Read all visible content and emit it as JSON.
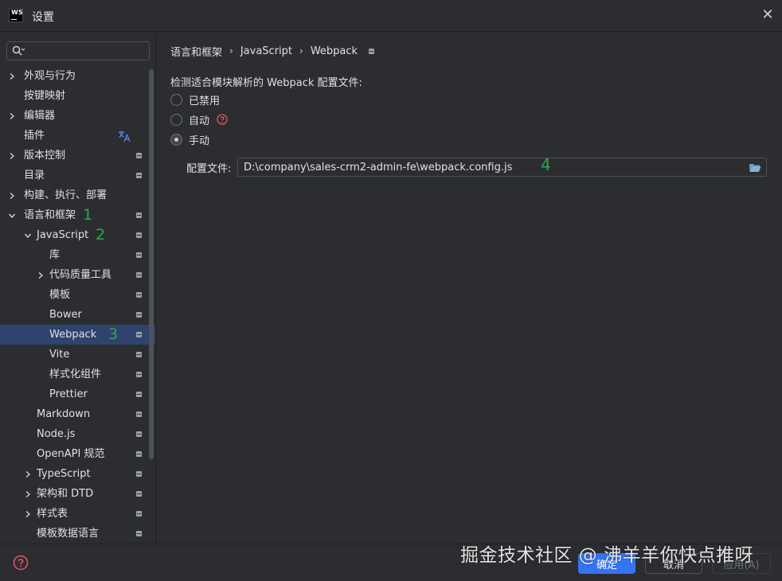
{
  "window": {
    "title": "设置",
    "logo_text": "WS"
  },
  "sidebar": {
    "search_placeholder": "",
    "items": [
      {
        "label": "外观与行为",
        "chevron": "right",
        "indent": 0,
        "badge": false
      },
      {
        "label": "按键映射",
        "chevron": null,
        "indent": 0,
        "badge": false
      },
      {
        "label": "编辑器",
        "chevron": "right",
        "indent": 0,
        "badge": false
      },
      {
        "label": "插件",
        "chevron": null,
        "indent": 0,
        "badge": false,
        "icon": "translate-icon"
      },
      {
        "label": "版本控制",
        "chevron": "right",
        "indent": 0,
        "badge": true
      },
      {
        "label": "目录",
        "chevron": null,
        "indent": 0,
        "badge": true
      },
      {
        "label": "构建、执行、部署",
        "chevron": "right",
        "indent": 0,
        "badge": false
      },
      {
        "label": "语言和框架",
        "chevron": "down",
        "indent": 0,
        "badge": true,
        "step": "1"
      },
      {
        "label": "JavaScript",
        "chevron": "down",
        "indent": 1,
        "badge": true,
        "step": "2"
      },
      {
        "label": "库",
        "chevron": null,
        "indent": 2,
        "badge": true
      },
      {
        "label": "代码质量工具",
        "chevron": "right",
        "indent": 2,
        "badge": true
      },
      {
        "label": "模板",
        "chevron": null,
        "indent": 2,
        "badge": true
      },
      {
        "label": "Bower",
        "chevron": null,
        "indent": 2,
        "badge": true
      },
      {
        "label": "Webpack",
        "chevron": null,
        "indent": 2,
        "badge": true,
        "selected": true,
        "step": "3"
      },
      {
        "label": "Vite",
        "chevron": null,
        "indent": 2,
        "badge": true
      },
      {
        "label": "样式化组件",
        "chevron": null,
        "indent": 2,
        "badge": true
      },
      {
        "label": "Prettier",
        "chevron": null,
        "indent": 2,
        "badge": true
      },
      {
        "label": "Markdown",
        "chevron": null,
        "indent": 1,
        "badge": true
      },
      {
        "label": "Node.js",
        "chevron": null,
        "indent": 1,
        "badge": true
      },
      {
        "label": "OpenAPI 规范",
        "chevron": null,
        "indent": 1,
        "badge": true
      },
      {
        "label": "TypeScript",
        "chevron": "right",
        "indent": 1,
        "badge": true
      },
      {
        "label": "架构和 DTD",
        "chevron": "right",
        "indent": 1,
        "badge": true
      },
      {
        "label": "样式表",
        "chevron": "right",
        "indent": 1,
        "badge": true
      },
      {
        "label": "模板数据语言",
        "chevron": null,
        "indent": 1,
        "badge": true
      }
    ]
  },
  "breadcrumb": {
    "items": [
      "语言和框架",
      "JavaScript",
      "Webpack"
    ],
    "separator": "›"
  },
  "main": {
    "section_label": "检测适合模块解析的 Webpack 配置文件:",
    "radios": [
      {
        "label": "已禁用",
        "checked": false
      },
      {
        "label": "自动",
        "checked": false,
        "help": true
      },
      {
        "label": "手动",
        "checked": true
      }
    ],
    "config_label": "配置文件:",
    "config_value": "D:\\company\\sales-crm2-admin-fe\\webpack.config.js",
    "config_step": "4"
  },
  "footer": {
    "ok_label": "确定",
    "cancel_label": "取消",
    "apply_label": "应用(A)"
  },
  "watermark": "掘金技术社区 @ 沸羊羊你快点推呀",
  "colors": {
    "accent": "#3574f0",
    "selected_row": "#2e436e",
    "step_number": "#2ea84a",
    "help_red": "#e55765"
  }
}
